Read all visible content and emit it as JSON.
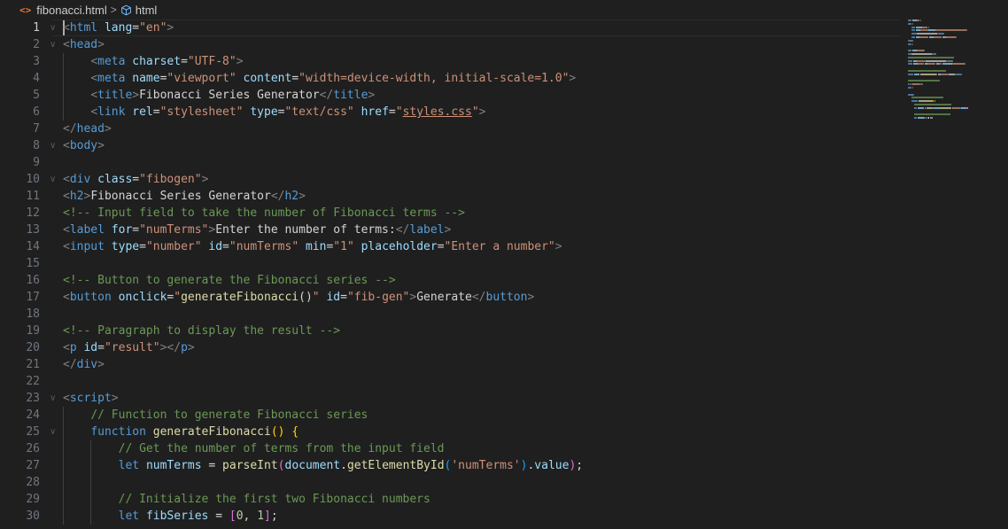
{
  "breadcrumb": {
    "file_icon": "<>",
    "file_name": "fibonacci.html",
    "separator": ">",
    "symbol_icon": "cube-icon",
    "symbol_name": "html"
  },
  "editor": {
    "active_line": 1,
    "lines": [
      {
        "n": "1",
        "fold": true,
        "tokens": [
          [
            "t-punc",
            "<"
          ],
          [
            "t-tag",
            "html"
          ],
          [
            "t-op",
            " "
          ],
          [
            "t-attr",
            "lang"
          ],
          [
            "t-op",
            "="
          ],
          [
            "t-str",
            "\"en\""
          ],
          [
            "t-punc",
            ">"
          ]
        ]
      },
      {
        "n": "2",
        "fold": true,
        "tokens": [
          [
            "t-punc",
            "<"
          ],
          [
            "t-tag",
            "head"
          ],
          [
            "t-punc",
            ">"
          ]
        ]
      },
      {
        "n": "3",
        "fold": false,
        "tokens": [
          [
            "t-op",
            "    "
          ],
          [
            "t-punc",
            "<"
          ],
          [
            "t-tag",
            "meta"
          ],
          [
            "t-op",
            " "
          ],
          [
            "t-attr",
            "charset"
          ],
          [
            "t-op",
            "="
          ],
          [
            "t-str",
            "\"UTF-8\""
          ],
          [
            "t-punc",
            ">"
          ]
        ]
      },
      {
        "n": "4",
        "fold": false,
        "tokens": [
          [
            "t-op",
            "    "
          ],
          [
            "t-punc",
            "<"
          ],
          [
            "t-tag",
            "meta"
          ],
          [
            "t-op",
            " "
          ],
          [
            "t-attr",
            "name"
          ],
          [
            "t-op",
            "="
          ],
          [
            "t-str",
            "\"viewport\""
          ],
          [
            "t-op",
            " "
          ],
          [
            "t-attr",
            "content"
          ],
          [
            "t-op",
            "="
          ],
          [
            "t-str",
            "\"width=device-width, initial-scale=1.0\""
          ],
          [
            "t-punc",
            ">"
          ]
        ]
      },
      {
        "n": "5",
        "fold": false,
        "tokens": [
          [
            "t-op",
            "    "
          ],
          [
            "t-punc",
            "<"
          ],
          [
            "t-tag",
            "title"
          ],
          [
            "t-punc",
            ">"
          ],
          [
            "t-text",
            "Fibonacci Series Generator"
          ],
          [
            "t-punc",
            "</"
          ],
          [
            "t-tag",
            "title"
          ],
          [
            "t-punc",
            ">"
          ]
        ]
      },
      {
        "n": "6",
        "fold": false,
        "tokens": [
          [
            "t-op",
            "    "
          ],
          [
            "t-punc",
            "<"
          ],
          [
            "t-tag",
            "link"
          ],
          [
            "t-op",
            " "
          ],
          [
            "t-attr",
            "rel"
          ],
          [
            "t-op",
            "="
          ],
          [
            "t-str",
            "\"stylesheet\""
          ],
          [
            "t-op",
            " "
          ],
          [
            "t-attr",
            "type"
          ],
          [
            "t-op",
            "="
          ],
          [
            "t-str",
            "\"text/css\""
          ],
          [
            "t-op",
            " "
          ],
          [
            "t-attr",
            "href"
          ],
          [
            "t-op",
            "="
          ],
          [
            "t-str",
            "\""
          ],
          [
            "t-str t-link",
            "styles.css"
          ],
          [
            "t-str",
            "\""
          ],
          [
            "t-punc",
            ">"
          ]
        ]
      },
      {
        "n": "7",
        "fold": false,
        "tokens": [
          [
            "t-punc",
            "</"
          ],
          [
            "t-tag",
            "head"
          ],
          [
            "t-punc",
            ">"
          ]
        ]
      },
      {
        "n": "8",
        "fold": true,
        "tokens": [
          [
            "t-punc",
            "<"
          ],
          [
            "t-tag",
            "body"
          ],
          [
            "t-punc",
            ">"
          ]
        ]
      },
      {
        "n": "9",
        "fold": false,
        "tokens": []
      },
      {
        "n": "10",
        "fold": true,
        "tokens": [
          [
            "t-punc",
            "<"
          ],
          [
            "t-tag",
            "div"
          ],
          [
            "t-op",
            " "
          ],
          [
            "t-attr",
            "class"
          ],
          [
            "t-op",
            "="
          ],
          [
            "t-str",
            "\"fibogen\""
          ],
          [
            "t-punc",
            ">"
          ]
        ]
      },
      {
        "n": "11",
        "fold": false,
        "tokens": [
          [
            "t-punc",
            "<"
          ],
          [
            "t-tag",
            "h2"
          ],
          [
            "t-punc",
            ">"
          ],
          [
            "t-text",
            "Fibonacci Series Generator"
          ],
          [
            "t-punc",
            "</"
          ],
          [
            "t-tag",
            "h2"
          ],
          [
            "t-punc",
            ">"
          ]
        ]
      },
      {
        "n": "12",
        "fold": false,
        "tokens": [
          [
            "t-com",
            "<!-- Input field to take the number of Fibonacci terms -->"
          ]
        ]
      },
      {
        "n": "13",
        "fold": false,
        "tokens": [
          [
            "t-punc",
            "<"
          ],
          [
            "t-tag",
            "label"
          ],
          [
            "t-op",
            " "
          ],
          [
            "t-attr",
            "for"
          ],
          [
            "t-op",
            "="
          ],
          [
            "t-str",
            "\"numTerms\""
          ],
          [
            "t-punc",
            ">"
          ],
          [
            "t-text",
            "Enter the number of terms:"
          ],
          [
            "t-punc",
            "</"
          ],
          [
            "t-tag",
            "label"
          ],
          [
            "t-punc",
            ">"
          ]
        ]
      },
      {
        "n": "14",
        "fold": false,
        "tokens": [
          [
            "t-punc",
            "<"
          ],
          [
            "t-tag",
            "input"
          ],
          [
            "t-op",
            " "
          ],
          [
            "t-attr",
            "type"
          ],
          [
            "t-op",
            "="
          ],
          [
            "t-str",
            "\"number\""
          ],
          [
            "t-op",
            " "
          ],
          [
            "t-attr",
            "id"
          ],
          [
            "t-op",
            "="
          ],
          [
            "t-str",
            "\"numTerms\""
          ],
          [
            "t-op",
            " "
          ],
          [
            "t-attr",
            "min"
          ],
          [
            "t-op",
            "="
          ],
          [
            "t-str",
            "\"1\""
          ],
          [
            "t-op",
            " "
          ],
          [
            "t-attr",
            "placeholder"
          ],
          [
            "t-op",
            "="
          ],
          [
            "t-str",
            "\"Enter a number\""
          ],
          [
            "t-punc",
            ">"
          ]
        ]
      },
      {
        "n": "15",
        "fold": false,
        "tokens": []
      },
      {
        "n": "16",
        "fold": false,
        "tokens": [
          [
            "t-com",
            "<!-- Button to generate the Fibonacci series -->"
          ]
        ]
      },
      {
        "n": "17",
        "fold": false,
        "tokens": [
          [
            "t-punc",
            "<"
          ],
          [
            "t-tag",
            "button"
          ],
          [
            "t-op",
            " "
          ],
          [
            "t-attr",
            "onclick"
          ],
          [
            "t-op",
            "="
          ],
          [
            "t-str",
            "\""
          ],
          [
            "t-fn",
            "generateFibonacci"
          ],
          [
            "t-op",
            "()"
          ],
          [
            "t-str",
            "\""
          ],
          [
            "t-op",
            " "
          ],
          [
            "t-attr",
            "id"
          ],
          [
            "t-op",
            "="
          ],
          [
            "t-str",
            "\"fib-gen\""
          ],
          [
            "t-punc",
            ">"
          ],
          [
            "t-text",
            "Generate"
          ],
          [
            "t-punc",
            "</"
          ],
          [
            "t-tag",
            "button"
          ],
          [
            "t-punc",
            ">"
          ]
        ]
      },
      {
        "n": "18",
        "fold": false,
        "tokens": []
      },
      {
        "n": "19",
        "fold": false,
        "tokens": [
          [
            "t-com",
            "<!-- Paragraph to display the result -->"
          ]
        ]
      },
      {
        "n": "20",
        "fold": false,
        "tokens": [
          [
            "t-punc",
            "<"
          ],
          [
            "t-tag",
            "p"
          ],
          [
            "t-op",
            " "
          ],
          [
            "t-attr",
            "id"
          ],
          [
            "t-op",
            "="
          ],
          [
            "t-str",
            "\"result\""
          ],
          [
            "t-punc",
            "></"
          ],
          [
            "t-tag",
            "p"
          ],
          [
            "t-punc",
            ">"
          ]
        ]
      },
      {
        "n": "21",
        "fold": false,
        "tokens": [
          [
            "t-punc",
            "</"
          ],
          [
            "t-tag",
            "div"
          ],
          [
            "t-punc",
            ">"
          ]
        ]
      },
      {
        "n": "22",
        "fold": false,
        "tokens": []
      },
      {
        "n": "23",
        "fold": true,
        "tokens": [
          [
            "t-punc",
            "<"
          ],
          [
            "t-tag",
            "script"
          ],
          [
            "t-punc",
            ">"
          ]
        ]
      },
      {
        "n": "24",
        "fold": false,
        "tokens": [
          [
            "t-op",
            "    "
          ],
          [
            "t-com",
            "// Function to generate Fibonacci series"
          ]
        ]
      },
      {
        "n": "25",
        "fold": true,
        "tokens": [
          [
            "t-op",
            "    "
          ],
          [
            "t-kw",
            "function"
          ],
          [
            "t-op",
            " "
          ],
          [
            "t-fn",
            "generateFibonacci"
          ],
          [
            "t-br1",
            "()"
          ],
          [
            "t-op",
            " "
          ],
          [
            "t-br1",
            "{"
          ]
        ]
      },
      {
        "n": "26",
        "fold": false,
        "tokens": [
          [
            "t-op",
            "        "
          ],
          [
            "t-com",
            "// Get the number of terms from the input field"
          ]
        ]
      },
      {
        "n": "27",
        "fold": false,
        "tokens": [
          [
            "t-op",
            "        "
          ],
          [
            "t-kw",
            "let"
          ],
          [
            "t-op",
            " "
          ],
          [
            "t-var",
            "numTerms"
          ],
          [
            "t-op",
            " = "
          ],
          [
            "t-fn",
            "parseInt"
          ],
          [
            "t-br2",
            "("
          ],
          [
            "t-var",
            "document"
          ],
          [
            "t-op",
            "."
          ],
          [
            "t-fn",
            "getElementById"
          ],
          [
            "t-br3",
            "("
          ],
          [
            "t-str",
            "'numTerms'"
          ],
          [
            "t-br3",
            ")"
          ],
          [
            "t-op",
            "."
          ],
          [
            "t-var",
            "value"
          ],
          [
            "t-br2",
            ")"
          ],
          [
            "t-op",
            ";"
          ]
        ]
      },
      {
        "n": "28",
        "fold": false,
        "tokens": []
      },
      {
        "n": "29",
        "fold": false,
        "tokens": [
          [
            "t-op",
            "        "
          ],
          [
            "t-com",
            "// Initialize the first two Fibonacci numbers"
          ]
        ]
      },
      {
        "n": "30",
        "fold": false,
        "tokens": [
          [
            "t-op",
            "        "
          ],
          [
            "t-kw",
            "let"
          ],
          [
            "t-op",
            " "
          ],
          [
            "t-var",
            "fibSeries"
          ],
          [
            "t-op",
            " = "
          ],
          [
            "t-br2",
            "["
          ],
          [
            "t-num",
            "0"
          ],
          [
            "t-op",
            ", "
          ],
          [
            "t-num",
            "1"
          ],
          [
            "t-br2",
            "]"
          ],
          [
            "t-op",
            ";"
          ]
        ]
      }
    ]
  },
  "colors": {
    "background": "#1f1f1f",
    "line_number": "#6e7681",
    "line_number_active": "#cccccc",
    "html_icon": "#e37933"
  }
}
